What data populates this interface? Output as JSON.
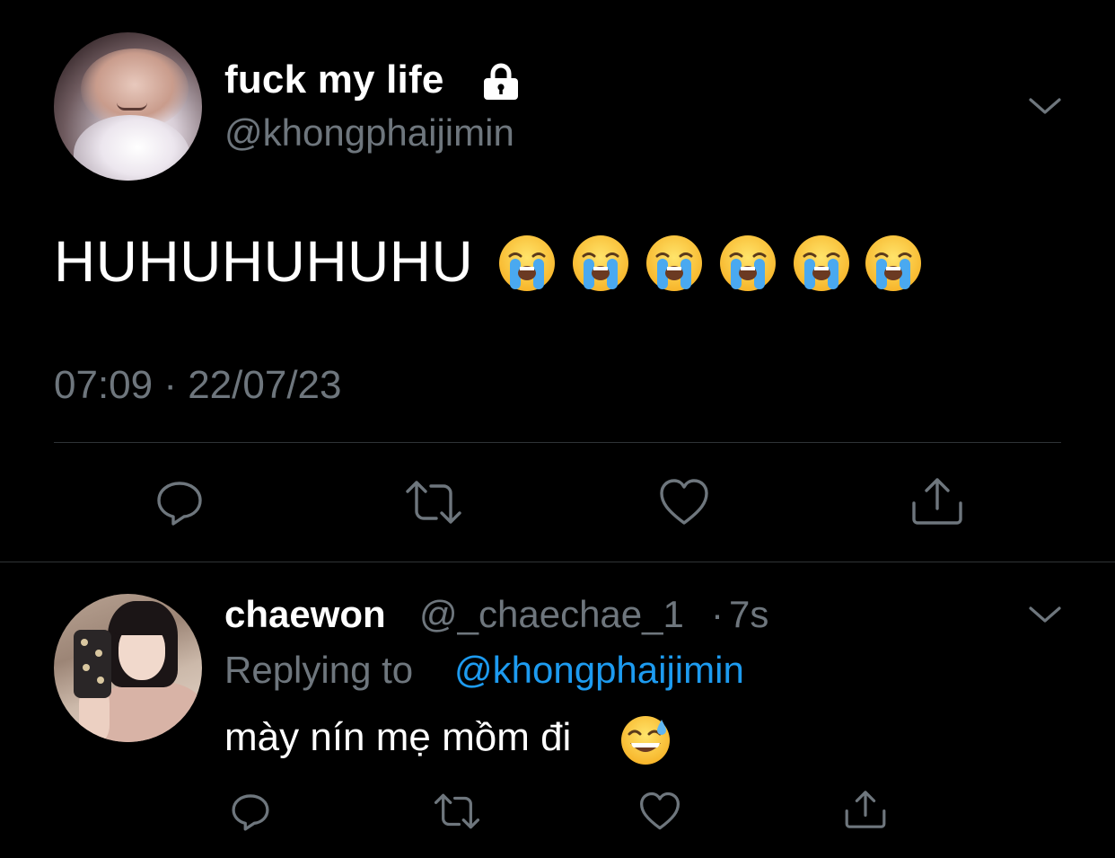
{
  "tweet": {
    "author": {
      "display_name": "fuck my life",
      "handle": "@khongphaijimin",
      "locked_icon": "lock-icon"
    },
    "text": "HUHUHUHUHU",
    "emojis": [
      "loudly-crying-face",
      "loudly-crying-face",
      "loudly-crying-face",
      "loudly-crying-face",
      "loudly-crying-face",
      "loudly-crying-face"
    ],
    "timestamp": "07:09 · 22/07/23",
    "actions": [
      "reply-icon",
      "retweet-icon",
      "like-icon",
      "share-icon"
    ]
  },
  "reply": {
    "display_name": "chaewon",
    "handle": "@_chaechae_1",
    "separator": "·",
    "time": "7s",
    "replying_label": "Replying to",
    "replying_to": "@khongphaijimin",
    "text": "mày nín mẹ mồm đi",
    "emoji": "grinning-face-with-sweat",
    "actions": [
      "reply-icon",
      "retweet-icon",
      "like-icon",
      "share-icon"
    ]
  },
  "colors": {
    "background": "#000000",
    "primary_text": "#ffffff",
    "secondary_text": "#6e767d",
    "link": "#1d9bf0",
    "divider": "#2f3336",
    "icon": "#6e767d"
  }
}
